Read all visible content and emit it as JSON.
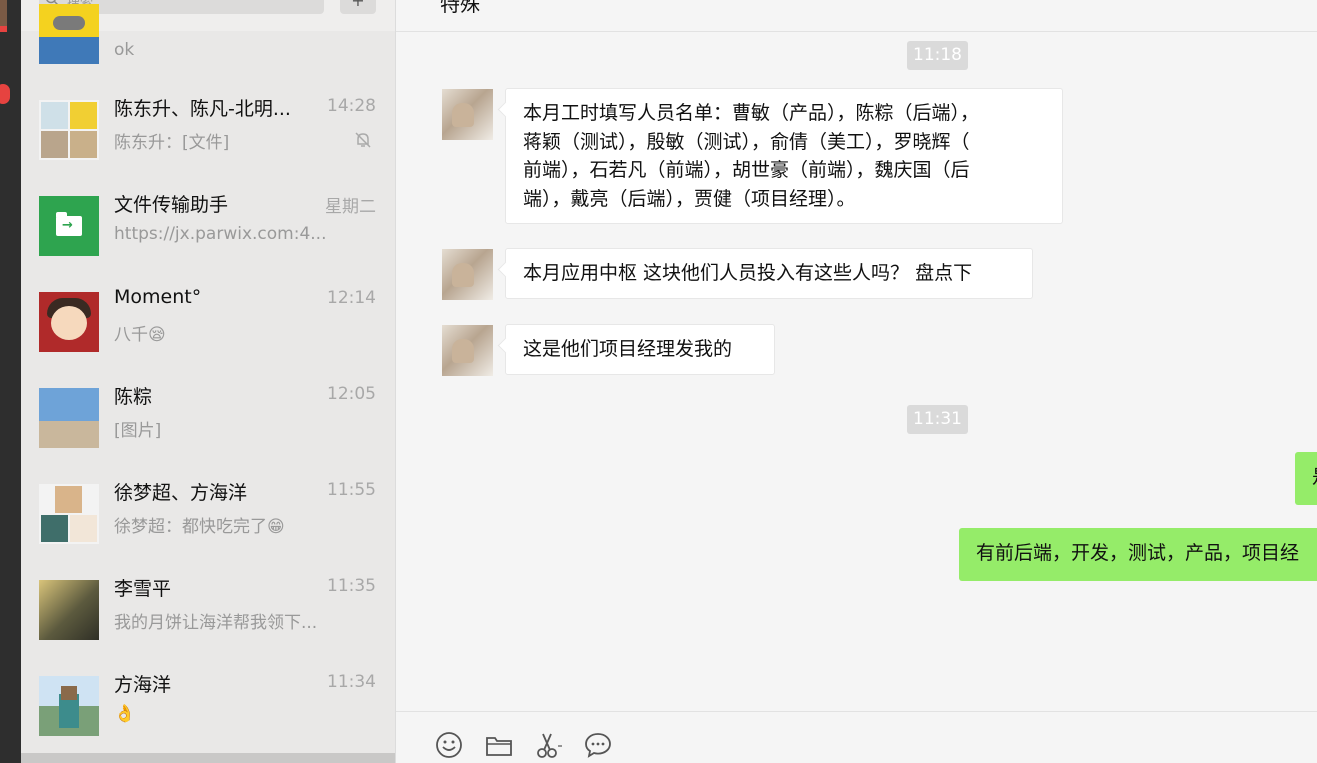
{
  "search": {
    "placeholder": "搜索"
  },
  "add_button": "+",
  "conversations": [
    {
      "name": "",
      "preview": "ok",
      "time": "",
      "avatar": "minion-icon"
    },
    {
      "name": "陈东升、陈凡-北明...",
      "preview": "陈东升：[文件]",
      "time": "14:28",
      "avatar": "group-avatar-icon",
      "muted": true
    },
    {
      "name": "文件传输助手",
      "preview": "https://jx.parwix.com:4...",
      "time": "星期二",
      "avatar": "file-transfer-icon"
    },
    {
      "name": "Moment°",
      "preview": "八千😪",
      "time": "12:14",
      "avatar": "cartoon-girl-icon"
    },
    {
      "name": "陈粽",
      "preview": "[图片]",
      "time": "12:05",
      "avatar": "beach-photo-icon"
    },
    {
      "name": "徐梦超、方海洋",
      "preview": "徐梦超：都快吃完了😁",
      "time": "11:55",
      "avatar": "group-avatar-icon"
    },
    {
      "name": "李雪平",
      "preview": "我的月饼让海洋帮我领下...",
      "time": "11:35",
      "avatar": "road-photo-icon"
    },
    {
      "name": "方海洋",
      "preview": "👌",
      "time": "11:34",
      "avatar": "minecraft-avatar-icon"
    }
  ],
  "chat": {
    "title": "特殊",
    "timestamps": [
      "11:18",
      "11:31"
    ],
    "incoming": [
      {
        "lines": [
          "本月工时填写人员名单：曹敏（产品），陈粽（后端），",
          "蒋颖（测试），殷敏（测试），俞倩（美工），罗晓辉（",
          "前端），石若凡（前端），胡世豪（前端），魏庆国（后",
          "端），戴亮（后端），贾健（项目经理）。"
        ]
      },
      {
        "lines": [
          "本月应用中枢 这块他们人员投入有这些人吗？ 盘点下"
        ]
      },
      {
        "lines": [
          "这是他们项目经理发我的"
        ]
      }
    ],
    "outgoing": [
      {
        "text": "是"
      },
      {
        "text": "有前后端，开发，测试，产品，项目经"
      }
    ]
  },
  "toolbar": [
    "emoji-icon",
    "folder-icon",
    "scissors-icon",
    "chat-bubble-icon"
  ],
  "colors": {
    "outgoing_bubble": "#95ec69",
    "incoming_bubble": "#ffffff",
    "list_bg": "#e9e8e7",
    "chat_bg": "#f5f5f5"
  }
}
